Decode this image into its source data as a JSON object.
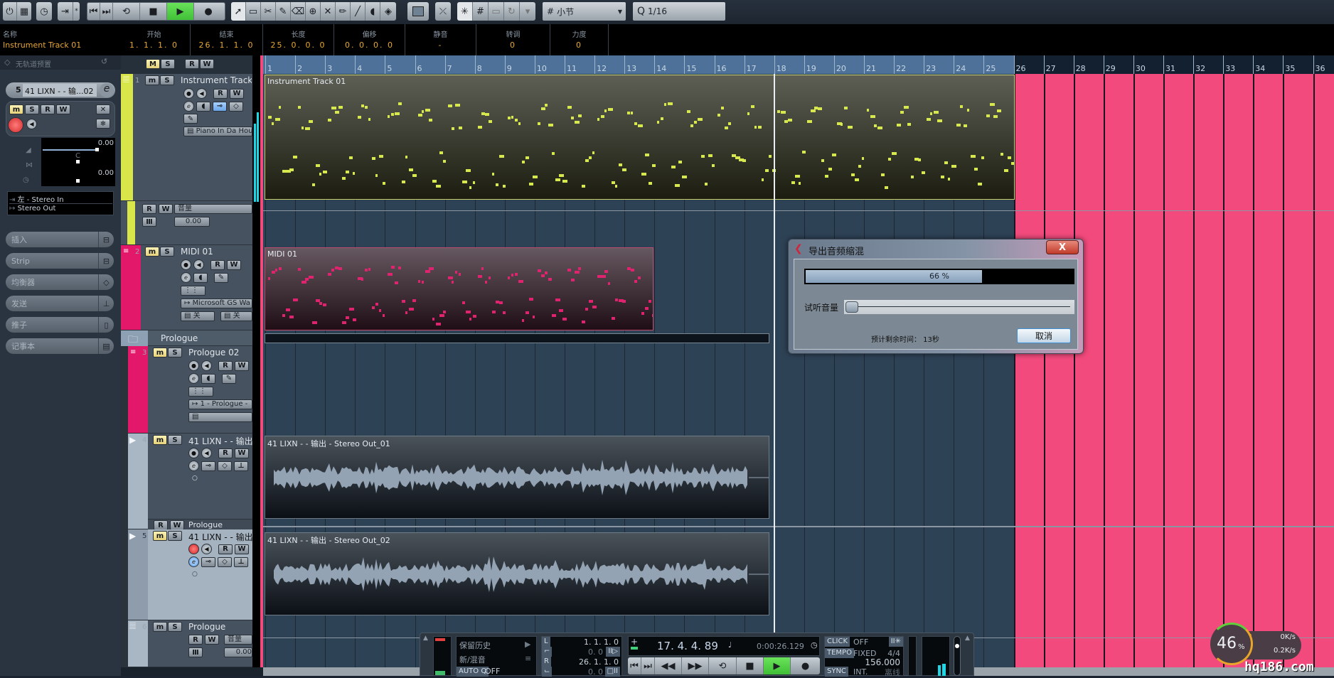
{
  "toolbar": {
    "transport_buttons": [
      "go-to-start",
      "go-to-end",
      "cycle",
      "stop",
      "play",
      "record"
    ],
    "tools": [
      "object-select",
      "range-select",
      "split",
      "glue",
      "erase",
      "zoom",
      "mute",
      "draw",
      "line",
      "play-tool",
      "color"
    ],
    "snap_type_label": "小节",
    "quantize_label": "1/16"
  },
  "infoline": {
    "columns": [
      {
        "header": "名称",
        "value": "Instrument Track 01"
      },
      {
        "header": "开始",
        "value": "1. 1. 1. 0"
      },
      {
        "header": "结束",
        "value": "26. 1. 1. 0"
      },
      {
        "header": "长度",
        "value": "25. 0. 0. 0"
      },
      {
        "header": "偏移",
        "value": "0. 0. 0. 0"
      },
      {
        "header": "静音",
        "value": "-"
      },
      {
        "header": "转调",
        "value": "0"
      },
      {
        "header": "力度",
        "value": "0"
      }
    ]
  },
  "inspector": {
    "preset_label": "无轨道预置",
    "track_number": "5",
    "track_name": "41 LIXN - - 输...02",
    "volume_value": "0.00",
    "pan_label": "C",
    "delay_value": "0.00",
    "input_routing": "左 - Stereo In",
    "output_routing": "Stereo Out",
    "sections": [
      "插入",
      "Strip",
      "均衡器",
      "发送",
      "推子",
      "记事本"
    ]
  },
  "tracklist_header": {
    "buttons": [
      "M",
      "S",
      "R",
      "W"
    ]
  },
  "tracks": [
    {
      "num": "1",
      "name": "Instrument Track 01",
      "color": "#d9e64a",
      "instrument": "Piano In Da Hous"
    },
    {
      "automation_param": "音量",
      "automation_value": "0.00"
    },
    {
      "num": "2",
      "name": "MIDI 01",
      "color": "#e3186a",
      "channel": "2",
      "output": "Microsoft GS Wa",
      "off1": "关",
      "off2": "关"
    },
    {
      "folder_name": "Prologue"
    },
    {
      "num": "3",
      "name": "Prologue 02",
      "color": "#e3186a",
      "channel": "1",
      "output": "1 - Prologue -"
    },
    {
      "num": "4",
      "name": "41 LIXN - - 输出 -",
      "color": "#a9b6c3",
      "sub_name": "Prologue"
    },
    {
      "num": "5",
      "name": "41 LIXN - - 输出 -",
      "color": "#a9b6c3"
    },
    {
      "num": "6",
      "name": "Prologue",
      "color": "#a9b6c3",
      "automation_param": "音量",
      "automation_value": "0.00"
    }
  ],
  "ruler": {
    "bars": [
      "1",
      "2",
      "3",
      "4",
      "5",
      "6",
      "7",
      "8",
      "9",
      "10",
      "11",
      "12",
      "13",
      "14",
      "15",
      "16",
      "17",
      "18",
      "19",
      "20",
      "21",
      "22",
      "23",
      "24",
      "25",
      "26",
      "27",
      "28",
      "29",
      "30",
      "31",
      "32",
      "33",
      "34",
      "35",
      "36"
    ]
  },
  "events": {
    "instrument_part": "Instrument Track 01",
    "midi_part": "MIDI 01",
    "audio1": "41 LIXN - - 输出 - Stereo Out_01",
    "audio2": "41 LIXN - - 输出 - Stereo Out_02"
  },
  "colors": {
    "instrument_note": "#d7e84e",
    "midi_note": "#e0236f",
    "cycle": "#f24a7c",
    "play_green": "#4fd642"
  },
  "dialog": {
    "title": "导出音频缩混",
    "close_label": "X",
    "progress_percent": 66,
    "progress_text": "66 %",
    "volume_label": "试听音量",
    "volume_level": 0,
    "eta_label": "预计剩余时间： 13秒",
    "cancel_label": "取消"
  },
  "transport": {
    "history_label": "保留历史",
    "new_mix_label": "新/混音",
    "autoq_label": "AUTO Q",
    "autoq_value": "OFF",
    "left_locator": "1. 1. 1. 0",
    "left_sub": "0. 0",
    "right_locator": "26. 1. 1. 0",
    "right_sub": "0. 0",
    "position_bars": "17. 4. 4. 89",
    "position_time": "0:00:26.129",
    "click_label": "CLICK",
    "click_value": "OFF",
    "tempo_label": "TEMPO",
    "tempo_mode": "FIXED",
    "signature": "4/4",
    "tempo_value": "156.000",
    "sync_label": "SYNC",
    "sync_value": "INT.",
    "offline_label": "离线"
  },
  "netmon": {
    "cpu_percent": "46",
    "up_speed": "0K/s",
    "down_speed": "0.2K/s"
  },
  "watermark": "hq186.com"
}
